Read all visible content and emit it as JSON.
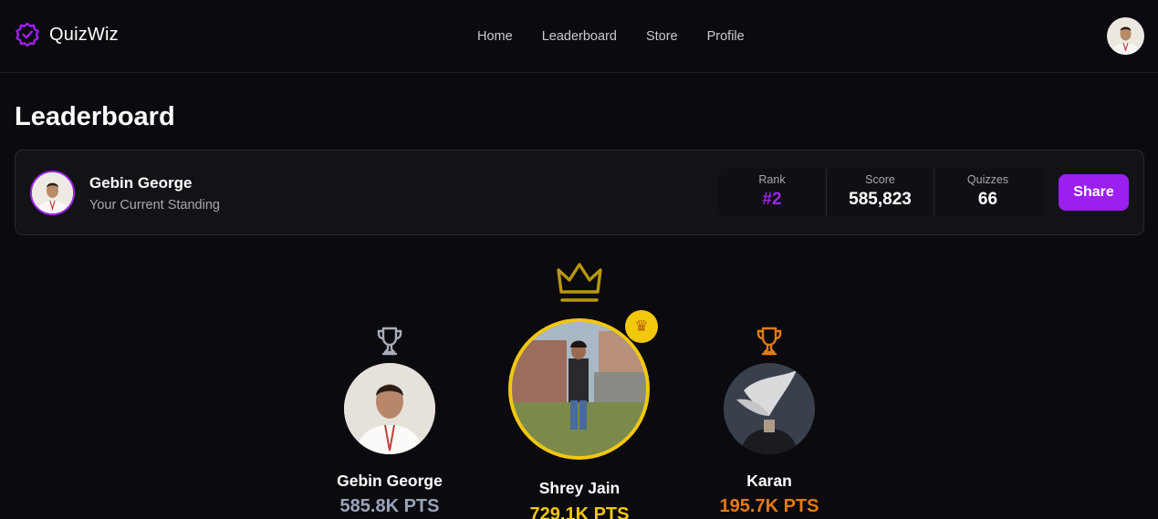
{
  "app": {
    "name": "QuizWiz",
    "logo_icon": "badge-check-icon",
    "accent": "#9b1ff0"
  },
  "nav": {
    "links": [
      {
        "label": "Home"
      },
      {
        "label": "Leaderboard"
      },
      {
        "label": "Store"
      },
      {
        "label": "Profile"
      }
    ],
    "avatar": "user-avatar"
  },
  "page": {
    "title": "Leaderboard"
  },
  "standing": {
    "name": "Gebin George",
    "subtitle": "Your Current Standing",
    "stats": [
      {
        "label": "Rank",
        "value": "#2"
      },
      {
        "label": "Score",
        "value": "585,823"
      },
      {
        "label": "Quizzes",
        "value": "66"
      }
    ],
    "share_label": "Share"
  },
  "podium": {
    "crown_icon": "crown-icon",
    "first": {
      "name": "Shrey Jain",
      "points": "729.1K PTS",
      "badge_icon": "crown-emoji-icon",
      "color": "#f2c80d"
    },
    "second": {
      "name": "Gebin George",
      "points": "585.8K PTS",
      "trophy_icon": "trophy-icon",
      "color": "#9aa3b8"
    },
    "third": {
      "name": "Karan",
      "points": "195.7K PTS",
      "trophy_icon": "trophy-icon",
      "color": "#e47a12"
    }
  }
}
